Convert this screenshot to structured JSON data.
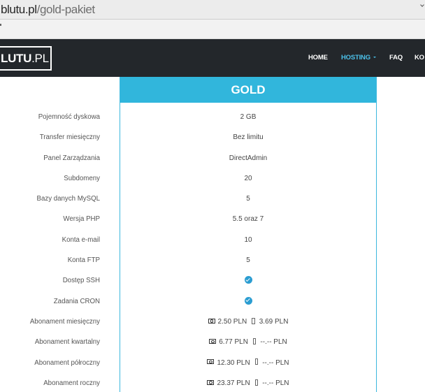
{
  "browser": {
    "url_domain": "blutu.pl",
    "url_path": "/gold-pakiet",
    "dropdown_icon": "chevron-down-icon"
  },
  "navbar": {
    "logo_main": "LUTU",
    "logo_suffix": ".PL",
    "items": [
      {
        "label": "HOME",
        "active": false
      },
      {
        "label": "HOSTING",
        "active": true,
        "has_dropdown": true,
        "icon": "caret-down-icon"
      },
      {
        "label": "FAQ",
        "active": false
      },
      {
        "label": "KO",
        "active": false
      }
    ]
  },
  "plan": {
    "name": "GOLD",
    "rows": [
      {
        "label": "Pojemność dyskowa",
        "value": "2 GB"
      },
      {
        "label": "Transfer miesięczny",
        "value": "Bez limitu"
      },
      {
        "label": "Panel Zarządzania",
        "value": "DirectAdmin"
      },
      {
        "label": "Subdomeny",
        "value": "20"
      },
      {
        "label": "Bazy danych MySQL",
        "value": "5"
      },
      {
        "label": "Wersja PHP",
        "value": "5.5 oraz 7"
      },
      {
        "label": "Konta e-mail",
        "value": "10"
      },
      {
        "label": "Konta FTP",
        "value": "5"
      },
      {
        "label": "Dostęp SSH",
        "included": true,
        "icon": "check-circle-icon"
      },
      {
        "label": "Zadania CRON",
        "included": true,
        "icon": "check-circle-icon"
      },
      {
        "label": "Abonament miesięczny",
        "prices": [
          {
            "icon": "money-icon",
            "value": "2.50 PLN"
          },
          {
            "icon": "mobile-icon",
            "value": "3.69 PLN"
          }
        ]
      },
      {
        "label": "Abonament kwartalny",
        "prices": [
          {
            "icon": "money-icon",
            "value": "6.77 PLN"
          },
          {
            "icon": "mobile-icon",
            "value": "--.-- PLN"
          }
        ]
      },
      {
        "label": "Abonament półroczny",
        "prices": [
          {
            "icon": "money-icon",
            "value": "12.30 PLN"
          },
          {
            "icon": "mobile-icon",
            "value": "--.-- PLN"
          }
        ]
      },
      {
        "label": "Abonament roczny",
        "prices": [
          {
            "icon": "money-icon",
            "value": "23.37 PLN"
          },
          {
            "icon": "mobile-icon",
            "value": "--.-- PLN"
          }
        ]
      }
    ]
  },
  "colors": {
    "chrome_background": "#ececec",
    "navbar_background": "#23272b",
    "nav_active": "#4cc1ea",
    "plan_accent": "#31b6dc",
    "check": "#2b9dd1"
  }
}
